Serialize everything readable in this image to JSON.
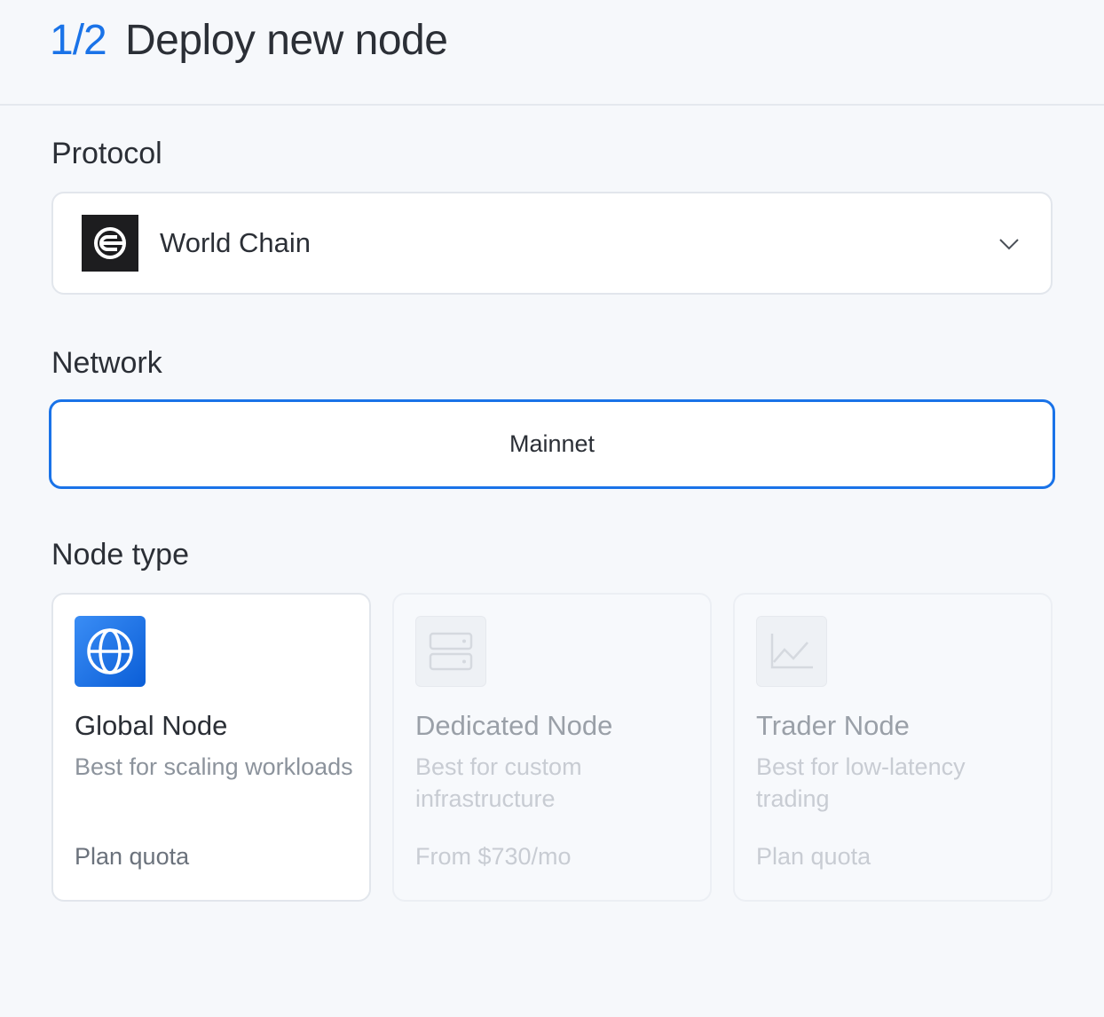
{
  "header": {
    "step": "1/2",
    "title": "Deploy new node"
  },
  "protocol": {
    "label": "Protocol",
    "selected": "World Chain",
    "icon": "world-chain-logo"
  },
  "network": {
    "label": "Network",
    "selected": "Mainnet"
  },
  "node_type": {
    "label": "Node type",
    "options": [
      {
        "title": "Global Node",
        "description": "Best for scaling workloads",
        "price": "Plan quota",
        "icon": "globe-icon",
        "state": "active"
      },
      {
        "title": "Dedicated Node",
        "description": "Best for custom infrastructure",
        "price": "From $730/mo",
        "icon": "server-icon",
        "state": "disabled"
      },
      {
        "title": "Trader Node",
        "description": "Best for low-latency trading",
        "price": "Plan quota",
        "icon": "chart-icon",
        "state": "disabled"
      }
    ]
  },
  "colors": {
    "accent": "#1a73e8",
    "background": "#f6f8fb",
    "text": "#2b2f36"
  }
}
